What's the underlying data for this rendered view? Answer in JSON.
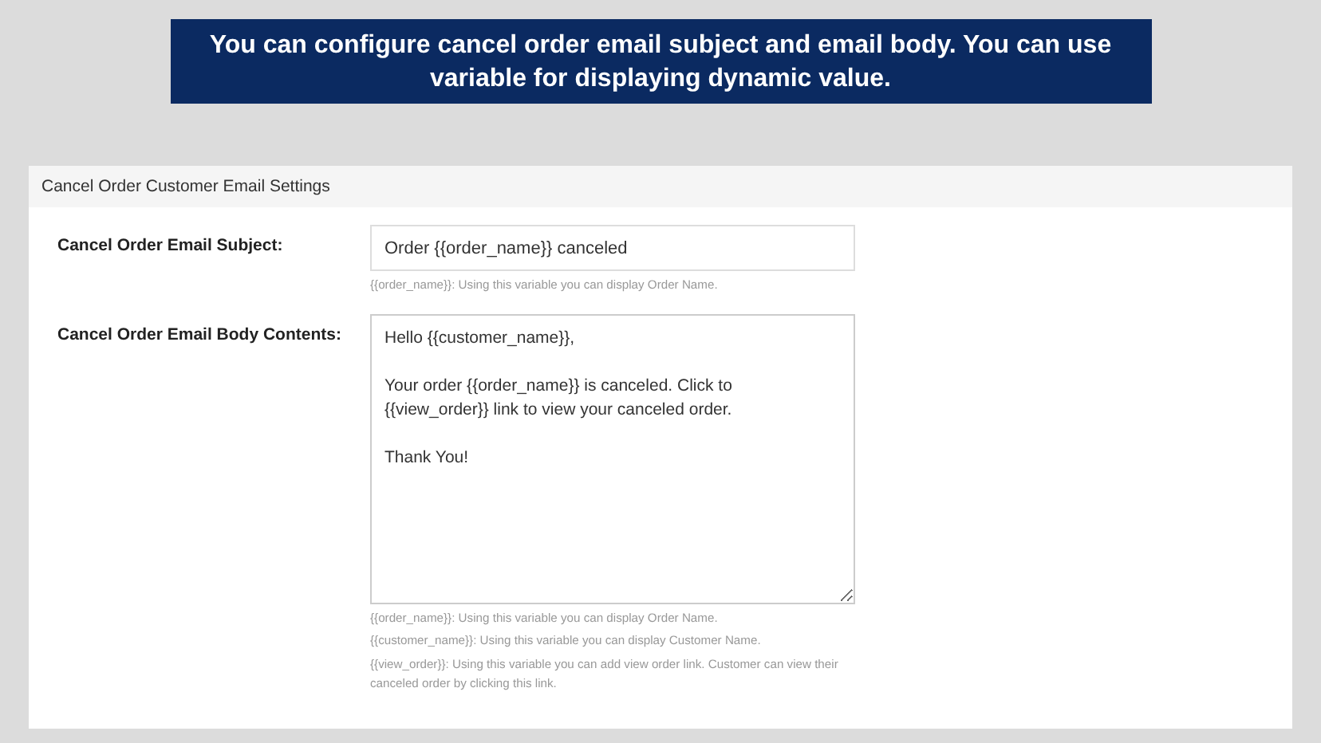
{
  "banner": {
    "text": "You can configure cancel order email subject and email body. You can use variable for displaying dynamic value."
  },
  "panel": {
    "title": "Cancel Order Customer Email Settings",
    "fields": [
      {
        "kind": "input",
        "label": "Cancel Order Email Subject:",
        "value": "Order {{order_name}} canceled",
        "notes": [
          "{{order_name}}: Using this variable you can display Order Name."
        ]
      },
      {
        "kind": "textarea",
        "label": "Cancel Order Email Body Contents:",
        "value": "Hello {{customer_name}},\n\nYour order {{order_name}} is canceled. Click to {{view_order}} link to view your canceled order.\n\nThank You!",
        "notes": [
          "{{order_name}}: Using this variable you can display Order Name.",
          "{{customer_name}}: Using this variable you can display Customer Name.",
          "{{view_order}}: Using this variable you can add view order link. Customer can view their canceled order by clicking this link."
        ]
      }
    ]
  }
}
